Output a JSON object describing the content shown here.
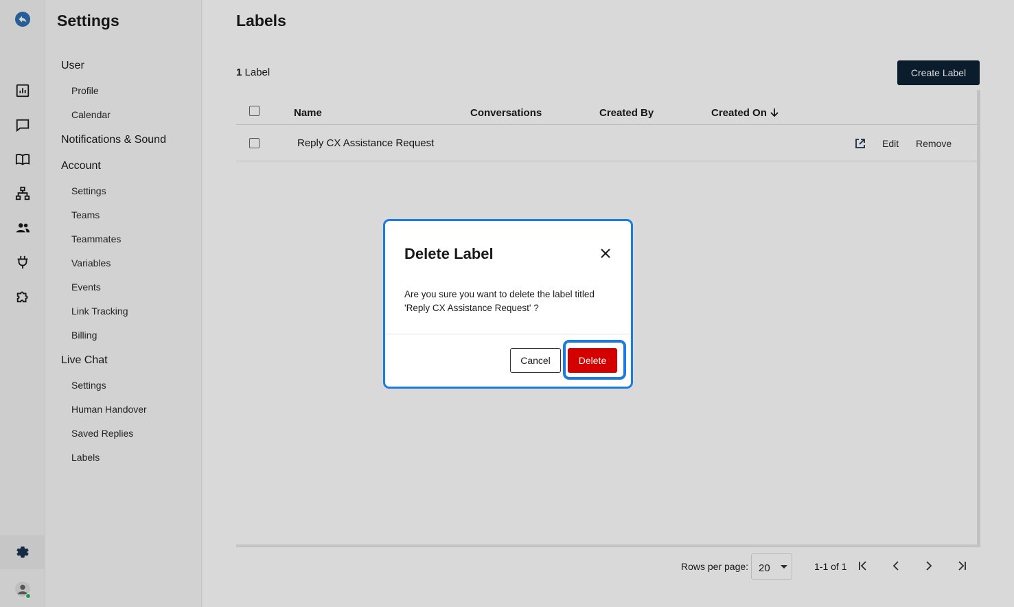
{
  "rail": {
    "icons": [
      "back-icon",
      "analytics-icon",
      "conversations-icon",
      "knowledge-book-icon",
      "flows-hierarchy-icon",
      "contacts-icon",
      "integrations-plug-icon",
      "extensions-puzzle-icon",
      "settings-gear-icon",
      "user-avatar-icon"
    ],
    "accent": "#2f6fb0",
    "status_color": "#2fb15c"
  },
  "sidebar": {
    "title": "Settings",
    "groups": [
      {
        "label": "User",
        "items": [
          "Profile",
          "Calendar"
        ]
      },
      {
        "label": "Notifications & Sound",
        "items": []
      },
      {
        "label": "Account",
        "items": [
          "Settings",
          "Teams",
          "Teammates",
          "Variables",
          "Events",
          "Link Tracking",
          "Billing"
        ]
      },
      {
        "label": "Live Chat",
        "items": [
          "Settings",
          "Human Handover",
          "Saved Replies",
          "Labels"
        ]
      }
    ]
  },
  "main": {
    "title": "Labels",
    "count_number": "1",
    "count_label": "Label",
    "create_button": "Create Label",
    "columns": [
      "Name",
      "Conversations",
      "Created By",
      "Created On"
    ],
    "sort_icon": "arrow-down-icon",
    "rows": [
      {
        "name": "Reply CX Assistance Request",
        "conversations": "",
        "created_by": "",
        "created_on": "",
        "edit": "Edit",
        "remove": "Remove"
      }
    ]
  },
  "pagination": {
    "rows_per_page_label": "Rows per page:",
    "rows_per_page_value": "20",
    "range": "1-1 of 1"
  },
  "dialog": {
    "title": "Delete Label",
    "message_line1": "Are you sure you want to delete the label titled",
    "message_line2": "'Reply CX Assistance Request' ?",
    "cancel": "Cancel",
    "delete": "Delete",
    "delete_color": "#d40000",
    "highlight_color": "#1a7be0"
  }
}
